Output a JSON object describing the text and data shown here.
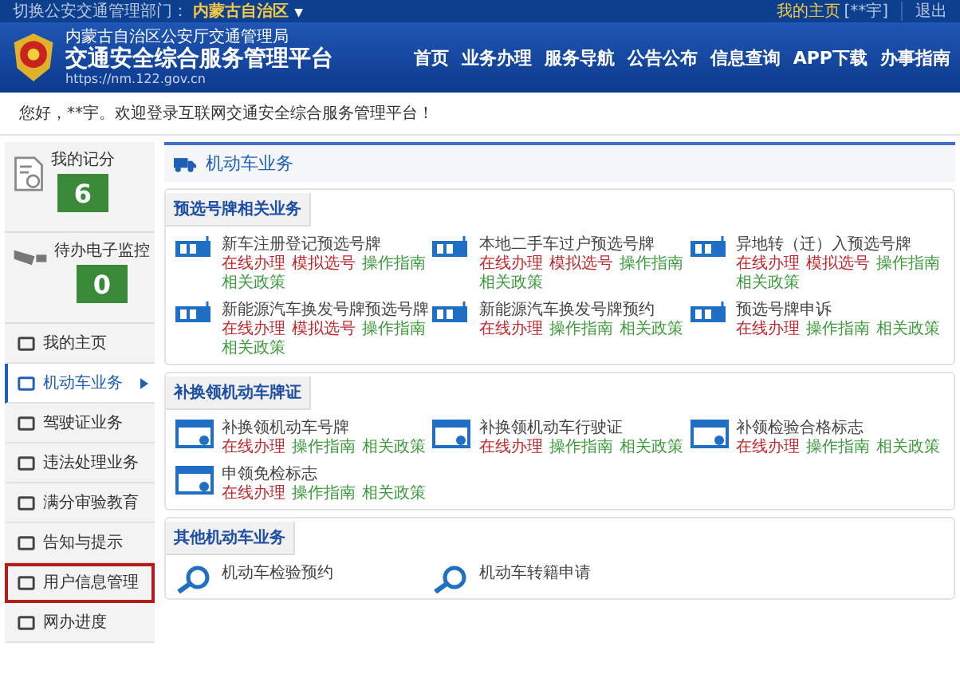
{
  "top_bar": {
    "switch_label": "切换公安交通管理部门：",
    "region": "内蒙古自治区",
    "region_caret": "▼",
    "home_link": "我的主页",
    "user": "[**宇]",
    "logout": "退出"
  },
  "header": {
    "bureau": "内蒙古自治区公安厅交通管理局",
    "title": "交通安全综合服务管理平台",
    "url": "https://nm.122.gov.cn",
    "nav": [
      {
        "label": "首页"
      },
      {
        "label": "业务办理"
      },
      {
        "label": "服务导航"
      },
      {
        "label": "公告公布"
      },
      {
        "label": "信息查询"
      },
      {
        "label": "APP下载"
      },
      {
        "label": "办事指南"
      }
    ]
  },
  "greeting": "您好，**宇。欢迎登录互联网交通安全综合服务管理平台！",
  "sidebar": {
    "scores": [
      {
        "label": "我的记分",
        "value": "6"
      },
      {
        "label": "待办电子监控",
        "value": "0"
      }
    ],
    "items": [
      {
        "label": "我的主页",
        "selected": false,
        "highlighted": false
      },
      {
        "label": "机动车业务",
        "selected": true,
        "highlighted": false
      },
      {
        "label": "驾驶证业务",
        "selected": false,
        "highlighted": false
      },
      {
        "label": "违法处理业务",
        "selected": false,
        "highlighted": false
      },
      {
        "label": "满分审验教育",
        "selected": false,
        "highlighted": false
      },
      {
        "label": "告知与提示",
        "selected": false,
        "highlighted": false
      },
      {
        "label": "用户信息管理",
        "selected": false,
        "highlighted": true
      },
      {
        "label": "网办进度",
        "selected": false,
        "highlighted": false
      }
    ]
  },
  "main": {
    "title": "机动车业务",
    "sections": [
      {
        "title": "预选号牌相关业务",
        "items": [
          {
            "name": "新车注册登记预选号牌",
            "links": [
              {
                "label": "在线办理",
                "color": "#c0282d"
              },
              {
                "label": "模拟选号",
                "color": "#c0282d"
              },
              {
                "label": "操作指南",
                "color": "#3a9a3a"
              },
              {
                "label": "相关政策",
                "color": "#3a9a3a"
              }
            ]
          },
          {
            "name": "本地二手车过户预选号牌",
            "links": [
              {
                "label": "在线办理",
                "color": "#c0282d"
              },
              {
                "label": "模拟选号",
                "color": "#c0282d"
              },
              {
                "label": "操作指南",
                "color": "#3a9a3a"
              },
              {
                "label": "相关政策",
                "color": "#3a9a3a"
              }
            ]
          },
          {
            "name": "异地转（迁）入预选号牌",
            "links": [
              {
                "label": "在线办理",
                "color": "#c0282d"
              },
              {
                "label": "模拟选号",
                "color": "#c0282d"
              },
              {
                "label": "操作指南",
                "color": "#3a9a3a"
              },
              {
                "label": "相关政策",
                "color": "#3a9a3a"
              }
            ]
          },
          {
            "name": "新能源汽车换发号牌预选号牌",
            "links": [
              {
                "label": "在线办理",
                "color": "#c0282d"
              },
              {
                "label": "模拟选号",
                "color": "#c0282d"
              },
              {
                "label": "操作指南",
                "color": "#3a9a3a"
              },
              {
                "label": "相关政策",
                "color": "#3a9a3a"
              }
            ]
          },
          {
            "name": "新能源汽车换发号牌预约",
            "links": [
              {
                "label": "在线办理",
                "color": "#c0282d"
              },
              {
                "label": "操作指南",
                "color": "#3a9a3a"
              },
              {
                "label": "相关政策",
                "color": "#3a9a3a"
              }
            ]
          },
          {
            "name": "预选号牌申诉",
            "links": [
              {
                "label": "在线办理",
                "color": "#c0282d"
              },
              {
                "label": "操作指南",
                "color": "#3a9a3a"
              },
              {
                "label": "相关政策",
                "color": "#3a9a3a"
              }
            ]
          }
        ]
      },
      {
        "title": "补换领机动车牌证",
        "items": [
          {
            "name": "补换领机动车号牌",
            "links": [
              {
                "label": "在线办理",
                "color": "#c0282d"
              },
              {
                "label": "操作指南",
                "color": "#3a9a3a"
              },
              {
                "label": "相关政策",
                "color": "#3a9a3a"
              }
            ]
          },
          {
            "name": "补换领机动车行驶证",
            "links": [
              {
                "label": "在线办理",
                "color": "#c0282d"
              },
              {
                "label": "操作指南",
                "color": "#3a9a3a"
              },
              {
                "label": "相关政策",
                "color": "#3a9a3a"
              }
            ]
          },
          {
            "name": "补领检验合格标志",
            "links": [
              {
                "label": "在线办理",
                "color": "#c0282d"
              },
              {
                "label": "操作指南",
                "color": "#3a9a3a"
              },
              {
                "label": "相关政策",
                "color": "#3a9a3a"
              }
            ]
          },
          {
            "name": "申领免检标志",
            "links": [
              {
                "label": "在线办理",
                "color": "#c0282d"
              },
              {
                "label": "操作指南",
                "color": "#3a9a3a"
              },
              {
                "label": "相关政策",
                "color": "#3a9a3a"
              }
            ]
          }
        ]
      },
      {
        "title": "其他机动车业务",
        "items": [
          {
            "name": "机动车检验预约"
          },
          {
            "name": "机动车转籍申请"
          }
        ]
      }
    ]
  }
}
